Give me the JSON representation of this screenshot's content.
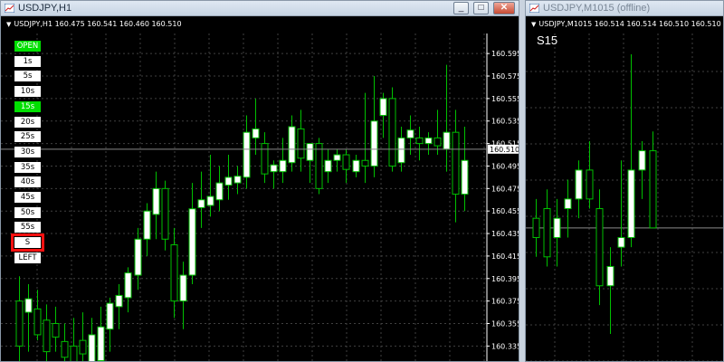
{
  "window1": {
    "title": "USDJPY,H1",
    "header_symbol": "USDJPY,H1",
    "header_quotes": "160.475 160.541 160.460 160.510",
    "buttons": [
      "_",
      "□",
      "✕"
    ],
    "current_price": "160.510",
    "y_ticks": [
      "160.595",
      "160.575",
      "160.555",
      "160.535",
      "160.515",
      "160.495",
      "160.475",
      "160.455",
      "160.435",
      "160.415",
      "160.395",
      "160.375",
      "160.355",
      "160.335"
    ],
    "panel_buttons": [
      {
        "label": "OPEN",
        "state": "on"
      },
      {
        "label": "1s",
        "state": "off"
      },
      {
        "label": "5s",
        "state": "off"
      },
      {
        "label": "10s",
        "state": "off"
      },
      {
        "label": "15s",
        "state": "on"
      },
      {
        "label": "20s",
        "state": "off"
      },
      {
        "label": "25s",
        "state": "off"
      },
      {
        "label": "30s",
        "state": "off"
      },
      {
        "label": "35s",
        "state": "off"
      },
      {
        "label": "40s",
        "state": "off"
      },
      {
        "label": "45s",
        "state": "off"
      },
      {
        "label": "50s",
        "state": "off"
      },
      {
        "label": "55s",
        "state": "off"
      },
      {
        "label": "S",
        "state": "selected"
      },
      {
        "label": "LEFT",
        "state": "off"
      }
    ]
  },
  "window2": {
    "title": "USDJPY,M1015 (offline)",
    "header_symbol": "USDJPY,M1015",
    "header_quotes": "160.514 160.514 160.510 160.510",
    "label": "S15"
  },
  "colors": {
    "bull": "#ffffff",
    "bear": "#000000",
    "candle_outline": "#00c000",
    "wick": "#00c000",
    "grid": "#404040",
    "on_button": "#00e000",
    "selected_outline": "#ff1010"
  },
  "chart_data": [
    {
      "type": "candlestick",
      "title": "USDJPY,H1",
      "ylim": [
        160.32,
        160.608
      ],
      "current_price": 160.51,
      "candles": [
        {
          "o": 160.375,
          "h": 160.397,
          "l": 160.31,
          "c": 160.335
        },
        {
          "o": 160.365,
          "h": 160.39,
          "l": 160.33,
          "c": 160.377
        },
        {
          "o": 160.368,
          "h": 160.385,
          "l": 160.34,
          "c": 160.345
        },
        {
          "o": 160.358,
          "h": 160.372,
          "l": 160.32,
          "c": 160.33
        },
        {
          "o": 160.355,
          "h": 160.37,
          "l": 160.33,
          "c": 160.343
        },
        {
          "o": 160.339,
          "h": 160.355,
          "l": 160.31,
          "c": 160.325
        },
        {
          "o": 160.335,
          "h": 160.36,
          "l": 160.3,
          "c": 160.32
        },
        {
          "o": 160.34,
          "h": 160.365,
          "l": 160.31,
          "c": 160.328
        },
        {
          "o": 160.313,
          "h": 160.36,
          "l": 160.3,
          "c": 160.345
        },
        {
          "o": 160.322,
          "h": 160.37,
          "l": 160.31,
          "c": 160.352
        },
        {
          "o": 160.35,
          "h": 160.378,
          "l": 160.33,
          "c": 160.373
        },
        {
          "o": 160.37,
          "h": 160.39,
          "l": 160.35,
          "c": 160.38
        },
        {
          "o": 160.378,
          "h": 160.405,
          "l": 160.365,
          "c": 160.4
        },
        {
          "o": 160.398,
          "h": 160.44,
          "l": 160.385,
          "c": 160.43
        },
        {
          "o": 160.43,
          "h": 160.462,
          "l": 160.415,
          "c": 160.455
        },
        {
          "o": 160.452,
          "h": 160.49,
          "l": 160.43,
          "c": 160.475
        },
        {
          "o": 160.475,
          "h": 160.482,
          "l": 160.42,
          "c": 160.43
        },
        {
          "o": 160.425,
          "h": 160.44,
          "l": 160.36,
          "c": 160.375
        },
        {
          "o": 160.375,
          "h": 160.41,
          "l": 160.35,
          "c": 160.398
        },
        {
          "o": 160.398,
          "h": 160.48,
          "l": 160.39,
          "c": 160.457
        },
        {
          "o": 160.458,
          "h": 160.49,
          "l": 160.44,
          "c": 160.465
        },
        {
          "o": 160.46,
          "h": 160.505,
          "l": 160.45,
          "c": 160.468
        },
        {
          "o": 160.465,
          "h": 160.495,
          "l": 160.455,
          "c": 160.48
        },
        {
          "o": 160.478,
          "h": 160.505,
          "l": 160.465,
          "c": 160.485
        },
        {
          "o": 160.48,
          "h": 160.495,
          "l": 160.47,
          "c": 160.486
        },
        {
          "o": 160.485,
          "h": 160.54,
          "l": 160.475,
          "c": 160.525
        },
        {
          "o": 160.52,
          "h": 160.555,
          "l": 160.505,
          "c": 160.528
        },
        {
          "o": 160.515,
          "h": 160.525,
          "l": 160.48,
          "c": 160.488
        },
        {
          "o": 160.49,
          "h": 160.5,
          "l": 160.475,
          "c": 160.496
        },
        {
          "o": 160.49,
          "h": 160.52,
          "l": 160.48,
          "c": 160.5
        },
        {
          "o": 160.498,
          "h": 160.54,
          "l": 160.49,
          "c": 160.53
        },
        {
          "o": 160.528,
          "h": 160.545,
          "l": 160.49,
          "c": 160.502
        },
        {
          "o": 160.5,
          "h": 160.515,
          "l": 160.48,
          "c": 160.515
        },
        {
          "o": 160.515,
          "h": 160.52,
          "l": 160.47,
          "c": 160.475
        },
        {
          "o": 160.49,
          "h": 160.51,
          "l": 160.48,
          "c": 160.5
        },
        {
          "o": 160.5,
          "h": 160.51,
          "l": 160.49,
          "c": 160.505
        },
        {
          "o": 160.505,
          "h": 160.51,
          "l": 160.48,
          "c": 160.492
        },
        {
          "o": 160.49,
          "h": 160.505,
          "l": 160.485,
          "c": 160.5
        },
        {
          "o": 160.5,
          "h": 160.56,
          "l": 160.48,
          "c": 160.495
        },
        {
          "o": 160.495,
          "h": 160.575,
          "l": 160.485,
          "c": 160.535
        },
        {
          "o": 160.54,
          "h": 160.56,
          "l": 160.52,
          "c": 160.555
        },
        {
          "o": 160.555,
          "h": 160.565,
          "l": 160.49,
          "c": 160.495
        },
        {
          "o": 160.498,
          "h": 160.53,
          "l": 160.49,
          "c": 160.52
        },
        {
          "o": 160.52,
          "h": 160.54,
          "l": 160.505,
          "c": 160.527
        },
        {
          "o": 160.52,
          "h": 160.53,
          "l": 160.5,
          "c": 160.515
        },
        {
          "o": 160.515,
          "h": 160.525,
          "l": 160.505,
          "c": 160.52
        },
        {
          "o": 160.52,
          "h": 160.545,
          "l": 160.505,
          "c": 160.513
        },
        {
          "o": 160.51,
          "h": 160.585,
          "l": 160.49,
          "c": 160.525
        },
        {
          "o": 160.525,
          "h": 160.545,
          "l": 160.445,
          "c": 160.47
        },
        {
          "o": 160.47,
          "h": 160.53,
          "l": 160.455,
          "c": 160.5
        }
      ]
    },
    {
      "type": "candlestick",
      "title": "USDJPY,M1015 (offline)",
      "current_price": 160.51,
      "candles": [
        {
          "o": 160.515,
          "h": 160.525,
          "l": 160.495,
          "c": 160.505
        },
        {
          "o": 160.52,
          "h": 160.53,
          "l": 160.49,
          "c": 160.495
        },
        {
          "o": 160.505,
          "h": 160.525,
          "l": 160.49,
          "c": 160.515
        },
        {
          "o": 160.52,
          "h": 160.535,
          "l": 160.505,
          "c": 160.525
        },
        {
          "o": 160.525,
          "h": 160.545,
          "l": 160.515,
          "c": 160.54
        },
        {
          "o": 160.54,
          "h": 160.555,
          "l": 160.52,
          "c": 160.525
        },
        {
          "o": 160.52,
          "h": 160.53,
          "l": 160.47,
          "c": 160.48
        },
        {
          "o": 160.48,
          "h": 160.5,
          "l": 160.455,
          "c": 160.49
        },
        {
          "o": 160.5,
          "h": 160.545,
          "l": 160.49,
          "c": 160.505
        },
        {
          "o": 160.505,
          "h": 160.6,
          "l": 160.5,
          "c": 160.54
        },
        {
          "o": 160.54,
          "h": 160.555,
          "l": 160.525,
          "c": 160.55
        },
        {
          "o": 160.55,
          "h": 160.56,
          "l": 160.51,
          "c": 160.51
        }
      ]
    }
  ]
}
